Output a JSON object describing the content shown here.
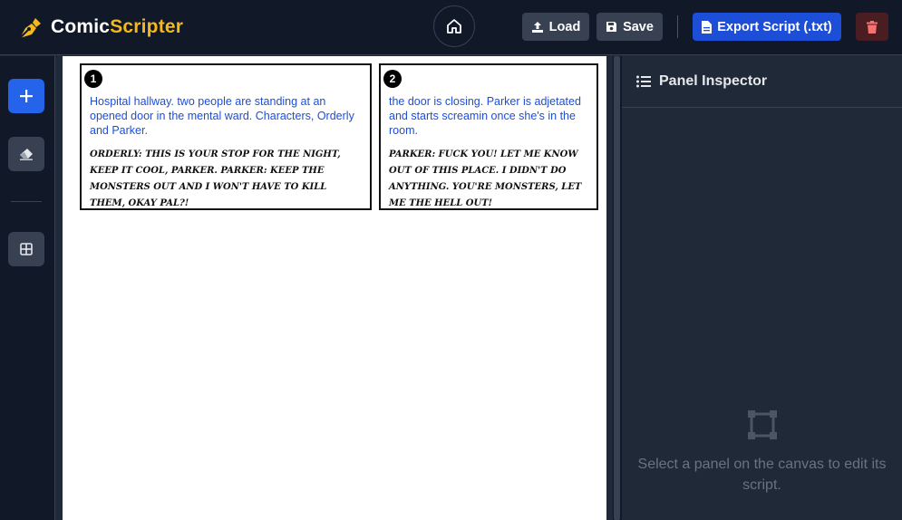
{
  "app": {
    "name_part1": "Comic",
    "name_part2": "Scripter"
  },
  "toolbar": {
    "load_label": "Load",
    "save_label": "Save",
    "export_label": "Export Script (.txt)"
  },
  "panels": [
    {
      "number": "1",
      "description": "Hospital hallway. two people are standing at an opened door in the mental ward. Characters, Orderly and Parker.",
      "dialogue": "ORDERLY: THIS IS YOUR STOP FOR THE NIGHT, KEEP IT COOL, PARKER.  PARKER: KEEP THE MONSTERS OUT AND I WON'T HAVE TO KILL THEM, OKAY PAL?!"
    },
    {
      "number": "2",
      "description": "the door is closing. Parker is adjetated and starts screamin once she's in the room.",
      "dialogue": "PARKER: FUCK YOU! LET ME KNOW OUT OF THIS PLACE. I DIDN'T DO ANYTHING. YOU'RE MONSTERS, LET ME THE HELL OUT!"
    }
  ],
  "inspector": {
    "title": "Panel Inspector",
    "empty_message": "Select a panel on the canvas to edit its script."
  },
  "colors": {
    "accent_yellow": "#f5b81c",
    "primary_blue": "#1d4ed8",
    "danger_red": "#f87171"
  }
}
